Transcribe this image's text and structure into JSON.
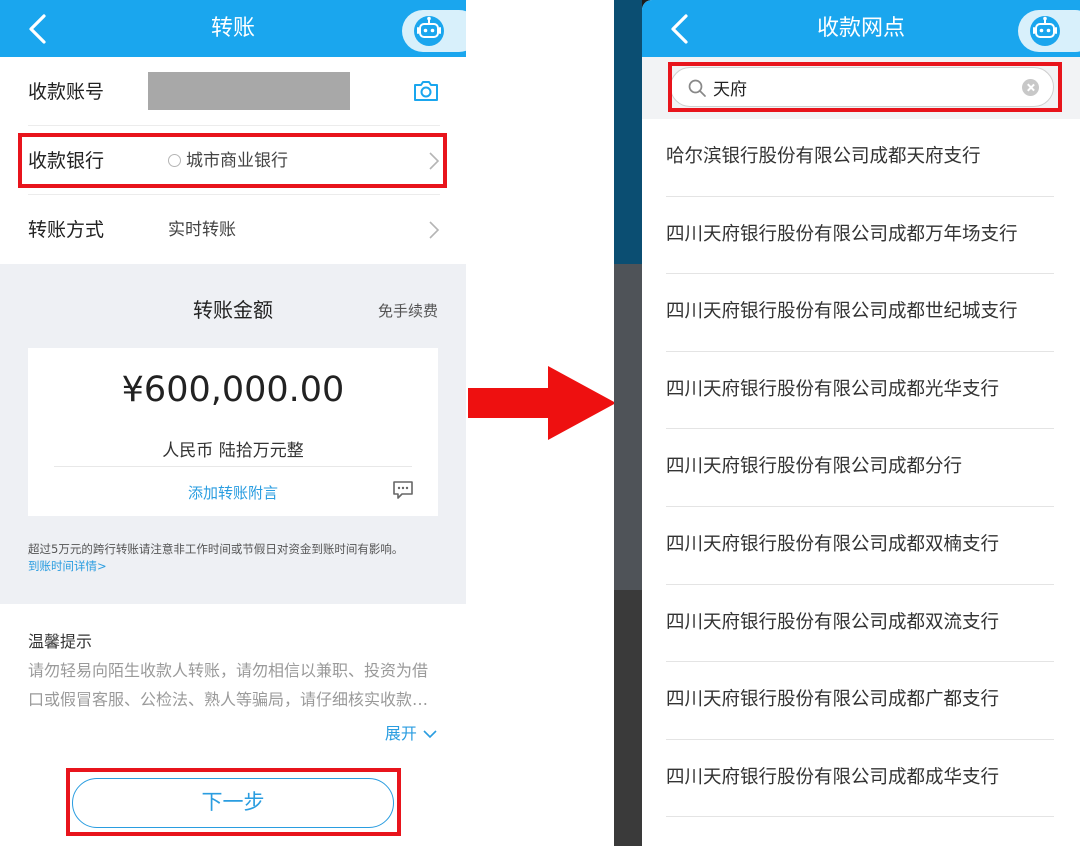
{
  "left": {
    "header": {
      "title": "转账"
    },
    "account_row": {
      "label": "收款账号"
    },
    "bank_row": {
      "label": "收款银行",
      "value": "城市商业银行"
    },
    "method_row": {
      "label": "转账方式",
      "value": "实时转账"
    },
    "amount": {
      "title": "转账金额",
      "fee_note": "免手续费",
      "value": "¥600,000.00",
      "in_words": "人民币 陆拾万元整",
      "add_note": "添加转账附言"
    },
    "notice": {
      "text": "超过5万元的跨行转账请注意非工作时间或节假日对资金到账时间有影响。",
      "link": "到账时间详情>"
    },
    "tips": {
      "title": "温馨提示",
      "body": "请勿轻易向陌生收款人转账，请勿相信以兼职、投资为借口或假冒客服、公检法、熟人等骗局，请仔细核实收款…",
      "expand": "展开"
    },
    "next_button": "下一步"
  },
  "right": {
    "header": {
      "title": "收款网点"
    },
    "search": {
      "value": "天府"
    },
    "branches": [
      "哈尔滨银行股份有限公司成都天府支行",
      "四川天府银行股份有限公司成都万年场支行",
      "四川天府银行股份有限公司成都世纪城支行",
      "四川天府银行股份有限公司成都光华支行",
      "四川天府银行股份有限公司成都分行",
      "四川天府银行股份有限公司成都双楠支行",
      "四川天府银行股份有限公司成都双流支行",
      "四川天府银行股份有限公司成都广都支行",
      "四川天府银行股份有限公司成都成华支行"
    ]
  },
  "colors": {
    "header_blue": "#1aa6ee",
    "link_blue": "#2a9de0",
    "highlight_red": "#e8141c"
  },
  "icons": [
    "back-icon",
    "robot-icon",
    "camera-icon",
    "bank-icon",
    "chevron-right-icon",
    "comment-icon",
    "chevron-down-icon",
    "search-icon",
    "clear-icon",
    "arrow-right-icon"
  ]
}
